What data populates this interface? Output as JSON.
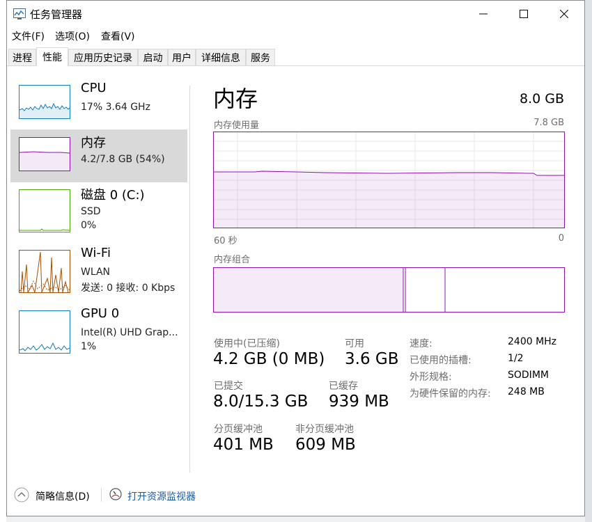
{
  "window": {
    "title": "任务管理器"
  },
  "menu": [
    "文件(F)",
    "选项(O)",
    "查看(V)"
  ],
  "tabs": [
    "进程",
    "性能",
    "应用历史记录",
    "启动",
    "用户",
    "详细信息",
    "服务"
  ],
  "sidebar": [
    {
      "title": "CPU",
      "sub1": "17% 3.64 GHz",
      "sub2": "",
      "sub3": ""
    },
    {
      "title": "内存",
      "sub1": "4.2/7.8 GB (54%)",
      "sub2": "",
      "sub3": ""
    },
    {
      "title": "磁盘 0 (C:)",
      "sub1": "SSD",
      "sub2": "0%",
      "sub3": ""
    },
    {
      "title": "Wi-Fi",
      "sub1": "WLAN",
      "sub2": "发送: 0 接收: 0 Kbps",
      "sub3": ""
    },
    {
      "title": "GPU 0",
      "sub1": "Intel(R) UHD Grap...",
      "sub2": "1%",
      "sub3": ""
    }
  ],
  "memory": {
    "title": "内存",
    "total": "8.0 GB",
    "usage_label": "内存使用量",
    "usage_max": "7.8 GB",
    "time_left": "60 秒",
    "time_right": "0",
    "composition_label": "内存组合",
    "in_use_fraction": 0.54
  },
  "stats": {
    "in_use_label": "使用中(已压缩)",
    "in_use_value": "4.2 GB (0 MB)",
    "available_label": "可用",
    "available_value": "3.6 GB",
    "committed_label": "已提交",
    "committed_value": "8.0/15.3 GB",
    "cached_label": "已缓存",
    "cached_value": "939 MB",
    "paged_label": "分页缓冲池",
    "paged_value": "401 MB",
    "nonpaged_label": "非分页缓冲池",
    "nonpaged_value": "609 MB"
  },
  "props": [
    {
      "label": "速度:",
      "value": "2400 MHz"
    },
    {
      "label": "已使用的插槽:",
      "value": "1/2"
    },
    {
      "label": "外形规格:",
      "value": "SODIMM"
    },
    {
      "label": "为硬件保留的内存:",
      "value": "248 MB"
    }
  ],
  "footer": {
    "brief": "简略信息(D)",
    "monitor": "打开资源监视器"
  },
  "colors": {
    "memory": "#8b12ae",
    "cpu": "#117dbb",
    "disk": "#4da60c",
    "wifi": "#a74f01"
  }
}
